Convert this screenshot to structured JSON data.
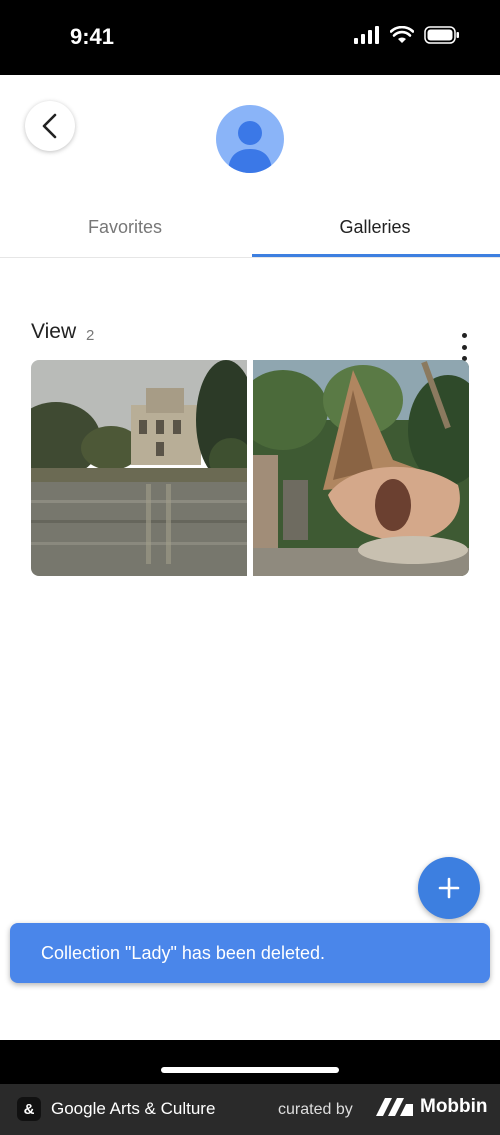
{
  "status_bar": {
    "time": "9:41"
  },
  "header": {
    "back_icon": "chevron-left-icon",
    "avatar_icon": "person-icon"
  },
  "tabs": [
    {
      "label": "Favorites",
      "selected": false
    },
    {
      "label": "Galleries",
      "selected": true
    }
  ],
  "gallery": {
    "title": "View",
    "count": "2",
    "images": [
      "lakeside-villa-photo",
      "wooden-sculpture-photo"
    ]
  },
  "fab": {
    "icon": "plus-icon"
  },
  "snackbar": {
    "message": "Collection \"Lady\" has been deleted."
  },
  "footer": {
    "app_name": "Google Arts & Culture",
    "curated_by": "curated by",
    "brand": "Mobbin"
  },
  "colors": {
    "accent": "#3d7fe0",
    "snackbar": "#4a86ea",
    "avatar": "#8ab4f8"
  }
}
